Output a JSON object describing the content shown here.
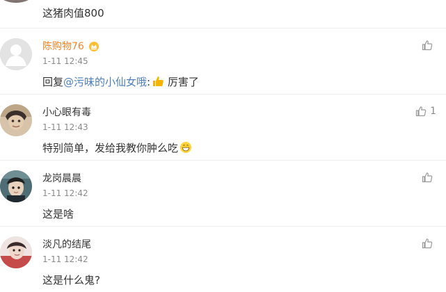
{
  "top_comment": {
    "text": "这猪肉值800",
    "avatar_icon": "avatar-partial"
  },
  "comments": [
    {
      "name": "陈购物76",
      "name_color": "#f58529",
      "badge_icon": "vip-crown-icon",
      "time": "1-11 12:45",
      "reply_prefix": "回复",
      "mention": "@污味的小仙女哦",
      "reply_suffix": ":",
      "reply_emoji": "thumbs-up-emoji",
      "reply_tail": " 厉害了",
      "like_count": "",
      "avatar_icon": "default-avatar"
    },
    {
      "name": "小心眼有毒",
      "time": "1-11 12:43",
      "text": "特别简单，发给我教你肿么吃",
      "text_emoji": "grin-emoji",
      "like_count": "1",
      "avatar_icon": "photo-avatar"
    },
    {
      "name": "龙岗晨晨",
      "time": "1-11 12:42",
      "text": "这是啥",
      "like_count": "",
      "avatar_icon": "photo-avatar"
    },
    {
      "name": "淡凡的结尾",
      "time": "1-11 12:42",
      "text": "这是什么鬼?",
      "like_count": "",
      "avatar_icon": "photo-avatar"
    }
  ],
  "icons": {
    "like": "thumb-up-outline-icon"
  },
  "colors": {
    "text": "#333333",
    "meta": "#8a8a8a",
    "link": "#4d7ebf",
    "accent_name": "#f58529",
    "divider": "#eeeeee"
  }
}
